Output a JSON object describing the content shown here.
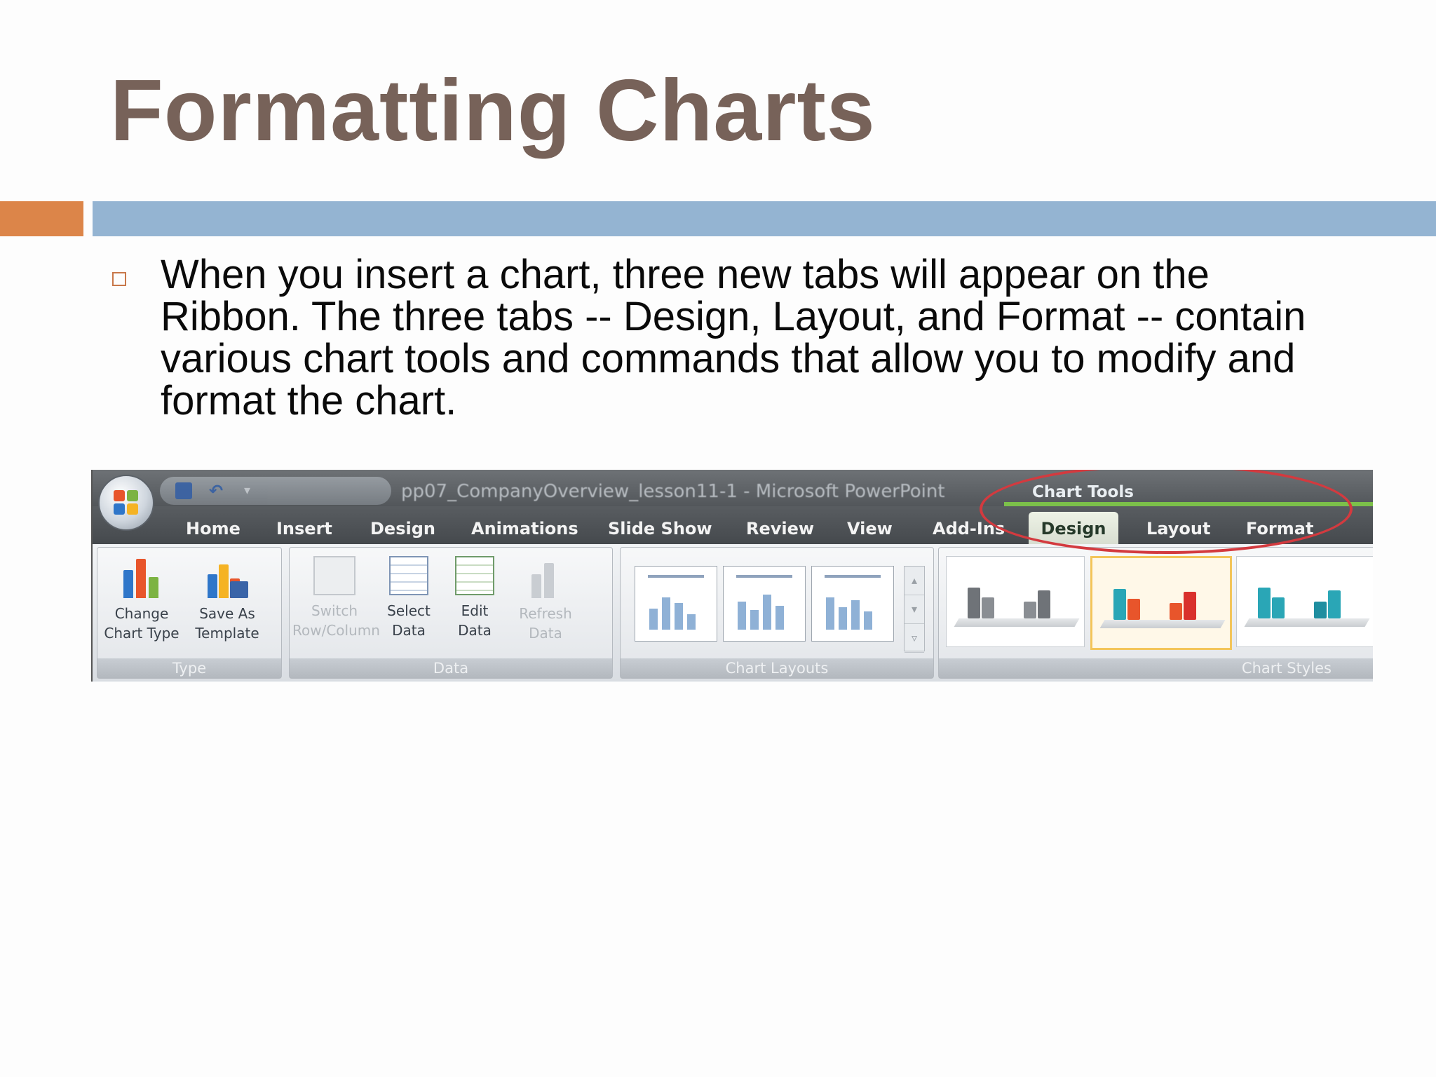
{
  "slide": {
    "title": "Formatting Charts",
    "bullet": "When you insert a chart, three new tabs will appear on the Ribbon. The three tabs -- Design, Layout, and Format -- contain various chart tools and commands that allow you to modify and format the chart."
  },
  "colors": {
    "title": "#776259",
    "accent_orange": "#dc8549",
    "rule_blue": "#94b4d2",
    "highlight_red": "#d33a3f"
  },
  "ribbon": {
    "window_title": "pp07_CompanyOverview_lesson11-1 - Microsoft PowerPoint",
    "context_label": "Chart Tools",
    "tabs": [
      "Home",
      "Insert",
      "Design",
      "Animations",
      "Slide Show",
      "Review",
      "View",
      "Add-Ins"
    ],
    "context_tabs": {
      "active": "Design",
      "others": [
        "Layout",
        "Format"
      ]
    },
    "groups": {
      "type": {
        "label": "Type",
        "commands": [
          {
            "label": "Change\nChart Type",
            "icon": "change-chart-type-icon"
          },
          {
            "label": "Save As\nTemplate",
            "icon": "save-as-template-icon"
          }
        ]
      },
      "data": {
        "label": "Data",
        "commands": [
          {
            "label": "Switch\nRow/Column",
            "icon": "switch-row-column-icon",
            "enabled": false
          },
          {
            "label": "Select\nData",
            "icon": "select-data-icon",
            "enabled": true
          },
          {
            "label": "Edit\nData",
            "icon": "edit-data-icon",
            "enabled": true
          },
          {
            "label": "Refresh\nData",
            "icon": "refresh-data-icon",
            "enabled": false
          }
        ]
      },
      "chart_layouts": {
        "label": "Chart Layouts"
      },
      "chart_styles": {
        "label": "Chart Styles"
      }
    }
  }
}
